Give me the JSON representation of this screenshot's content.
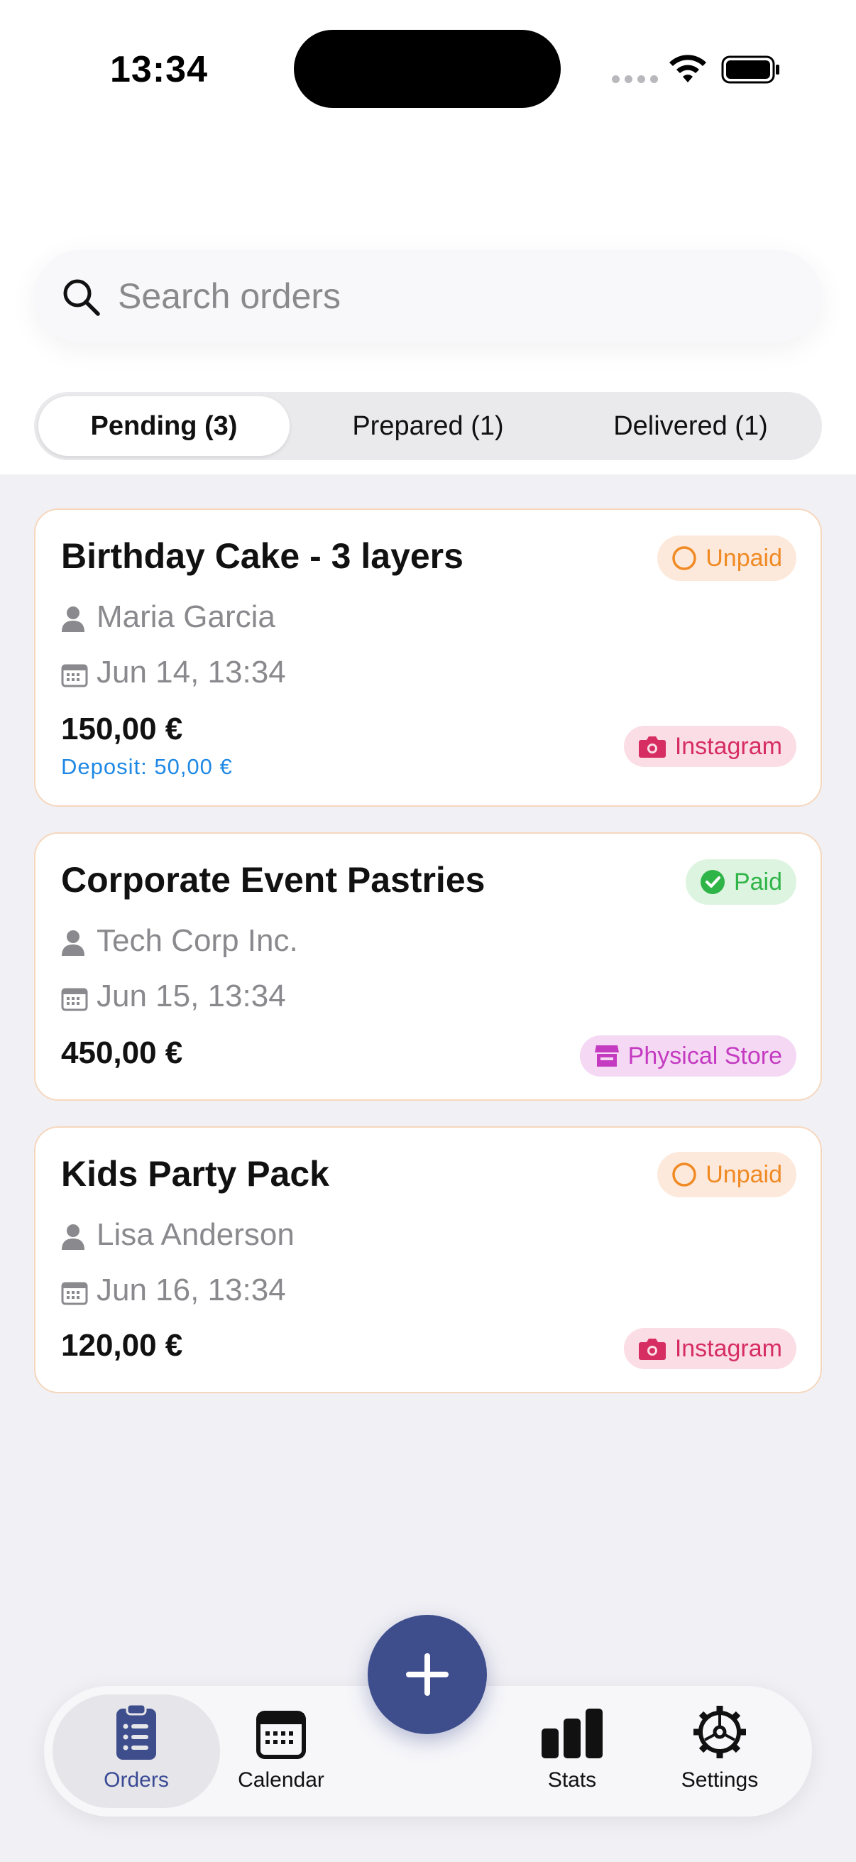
{
  "status_bar": {
    "time": "13:34"
  },
  "search": {
    "placeholder": "Search orders"
  },
  "segments": [
    {
      "label": "Pending (3)",
      "selected": true
    },
    {
      "label": "Prepared (1)",
      "selected": false
    },
    {
      "label": "Delivered (1)",
      "selected": false
    }
  ],
  "orders": [
    {
      "title": "Birthday Cake - 3 layers",
      "customer": "Maria Garcia",
      "date": "Jun 14, 13:34",
      "price": "150,00 €",
      "deposit": "Deposit: 50,00 €",
      "payment_status": "Unpaid",
      "channel": "Instagram"
    },
    {
      "title": "Corporate Event Pastries",
      "customer": "Tech Corp Inc.",
      "date": "Jun 15, 13:34",
      "price": "450,00 €",
      "payment_status": "Paid",
      "channel": "Physical Store"
    },
    {
      "title": "Kids Party Pack",
      "customer": "Lisa Anderson",
      "date": "Jun 16, 13:34",
      "price": "120,00 €",
      "payment_status": "Unpaid",
      "channel": "Instagram"
    }
  ],
  "tabbar": {
    "orders": "Orders",
    "calendar": "Calendar",
    "stats": "Stats",
    "settings": "Settings"
  },
  "colors": {
    "accent": "#3e4d8c",
    "unpaid": "#f08a24",
    "paid": "#2fb448",
    "instagram": "#d62d62",
    "store": "#c43bc1",
    "deposit": "#1e88e5",
    "card_border": "#f6d7bd"
  },
  "icons": [
    "search-icon",
    "person-icon",
    "calendar-icon",
    "circle-icon",
    "checkmark-circle-icon",
    "camera-icon",
    "store-icon",
    "clipboard-list-icon",
    "bar-chart-icon",
    "gear-icon",
    "plus-icon",
    "wifi-icon",
    "battery-icon"
  ]
}
